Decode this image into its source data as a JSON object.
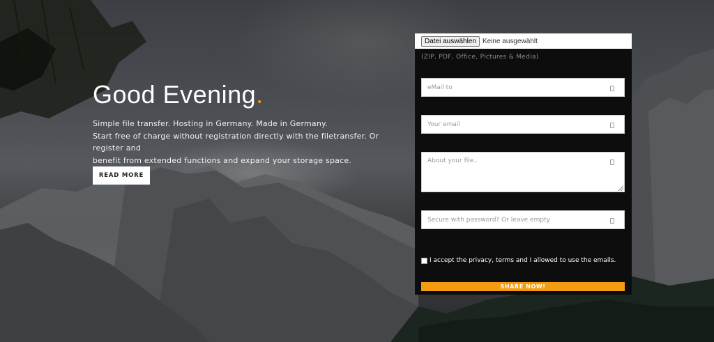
{
  "hero": {
    "title": "Good Evening",
    "title_dot": ".",
    "lines": [
      "Simple file transfer. Hosting in Germany. Made in Germany.",
      "Start free of charge without registration directly with the filetransfer. Or register and",
      "benefit from extended functions and expand your storage space."
    ],
    "read_more_label": "READ MORE"
  },
  "upload_form": {
    "file_button_label": "Datei auswählen",
    "file_status": "Keine ausgewählt",
    "file_types_hint": "(ZIP, PDF, Office, Pictures & Media)",
    "email_to_placeholder": "eMail to",
    "your_email_placeholder": "Your email",
    "about_file_placeholder": "About your file..",
    "password_placeholder": "Secure with password? Or leave empty",
    "accept_label": "I accept the privacy, terms and I allowed to use the emails.",
    "accept_checked": false,
    "share_label": "SHARE NOW!"
  },
  "colors": {
    "accent": "#f39c12",
    "panel_background": "#0d0d0d",
    "button_background": "#ffffff"
  }
}
